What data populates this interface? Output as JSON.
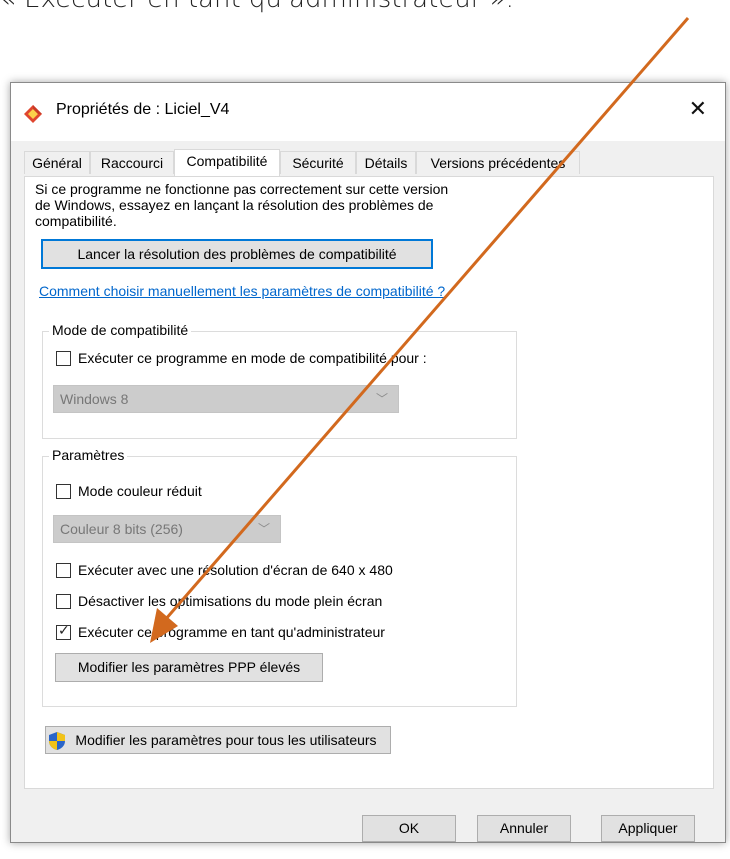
{
  "caption": "« Exécuter en tant qu'administrateur ».",
  "window": {
    "title": "Propriétés de : Liciel_V4",
    "close_glyph": "✕"
  },
  "tabs": [
    "Général",
    "Raccourci",
    "Compatibilité",
    "Sécurité",
    "Détails",
    "Versions précédentes"
  ],
  "active_tab": "Compatibilité",
  "intro_text": [
    "Si ce programme ne fonctionne pas correctement sur cette version",
    "de Windows, essayez en lançant la résolution des problèmes de",
    "compatibilité."
  ],
  "troubleshoot_button": "Lancer la résolution des problèmes de compatibilité",
  "manual_link": "Comment choisir manuellement les paramètres de compatibilité ?",
  "compat_mode": {
    "legend": "Mode de compatibilité",
    "checkbox_label": "Exécuter ce programme en mode de compatibilité pour :",
    "checked": false,
    "select_value": "Windows 8"
  },
  "settings": {
    "legend": "Paramètres",
    "reduced_color": {
      "label": "Mode couleur réduit",
      "checked": false
    },
    "color_select": "Couleur 8 bits (256)",
    "resolution": {
      "label": "Exécuter avec une résolution d'écran de 640 x 480",
      "checked": false
    },
    "fullscreen": {
      "label": "Désactiver les optimisations du mode plein écran",
      "checked": false
    },
    "admin": {
      "label": "Exécuter ce programme en tant qu'administrateur",
      "checked": true
    },
    "dpi_button": "Modifier les paramètres PPP élevés"
  },
  "all_users_button": "Modifier les paramètres pour tous les utilisateurs",
  "footer": {
    "ok": "OK",
    "cancel": "Annuler",
    "apply": "Appliquer"
  },
  "colors": {
    "arrow": "#d2691e",
    "link": "#0066cc",
    "focus": "#0078d7"
  },
  "icons": {
    "app": "liciel-app-icon",
    "shield": "uac-shield-icon",
    "close": "close-icon",
    "chevron": "chevron-down-icon"
  }
}
